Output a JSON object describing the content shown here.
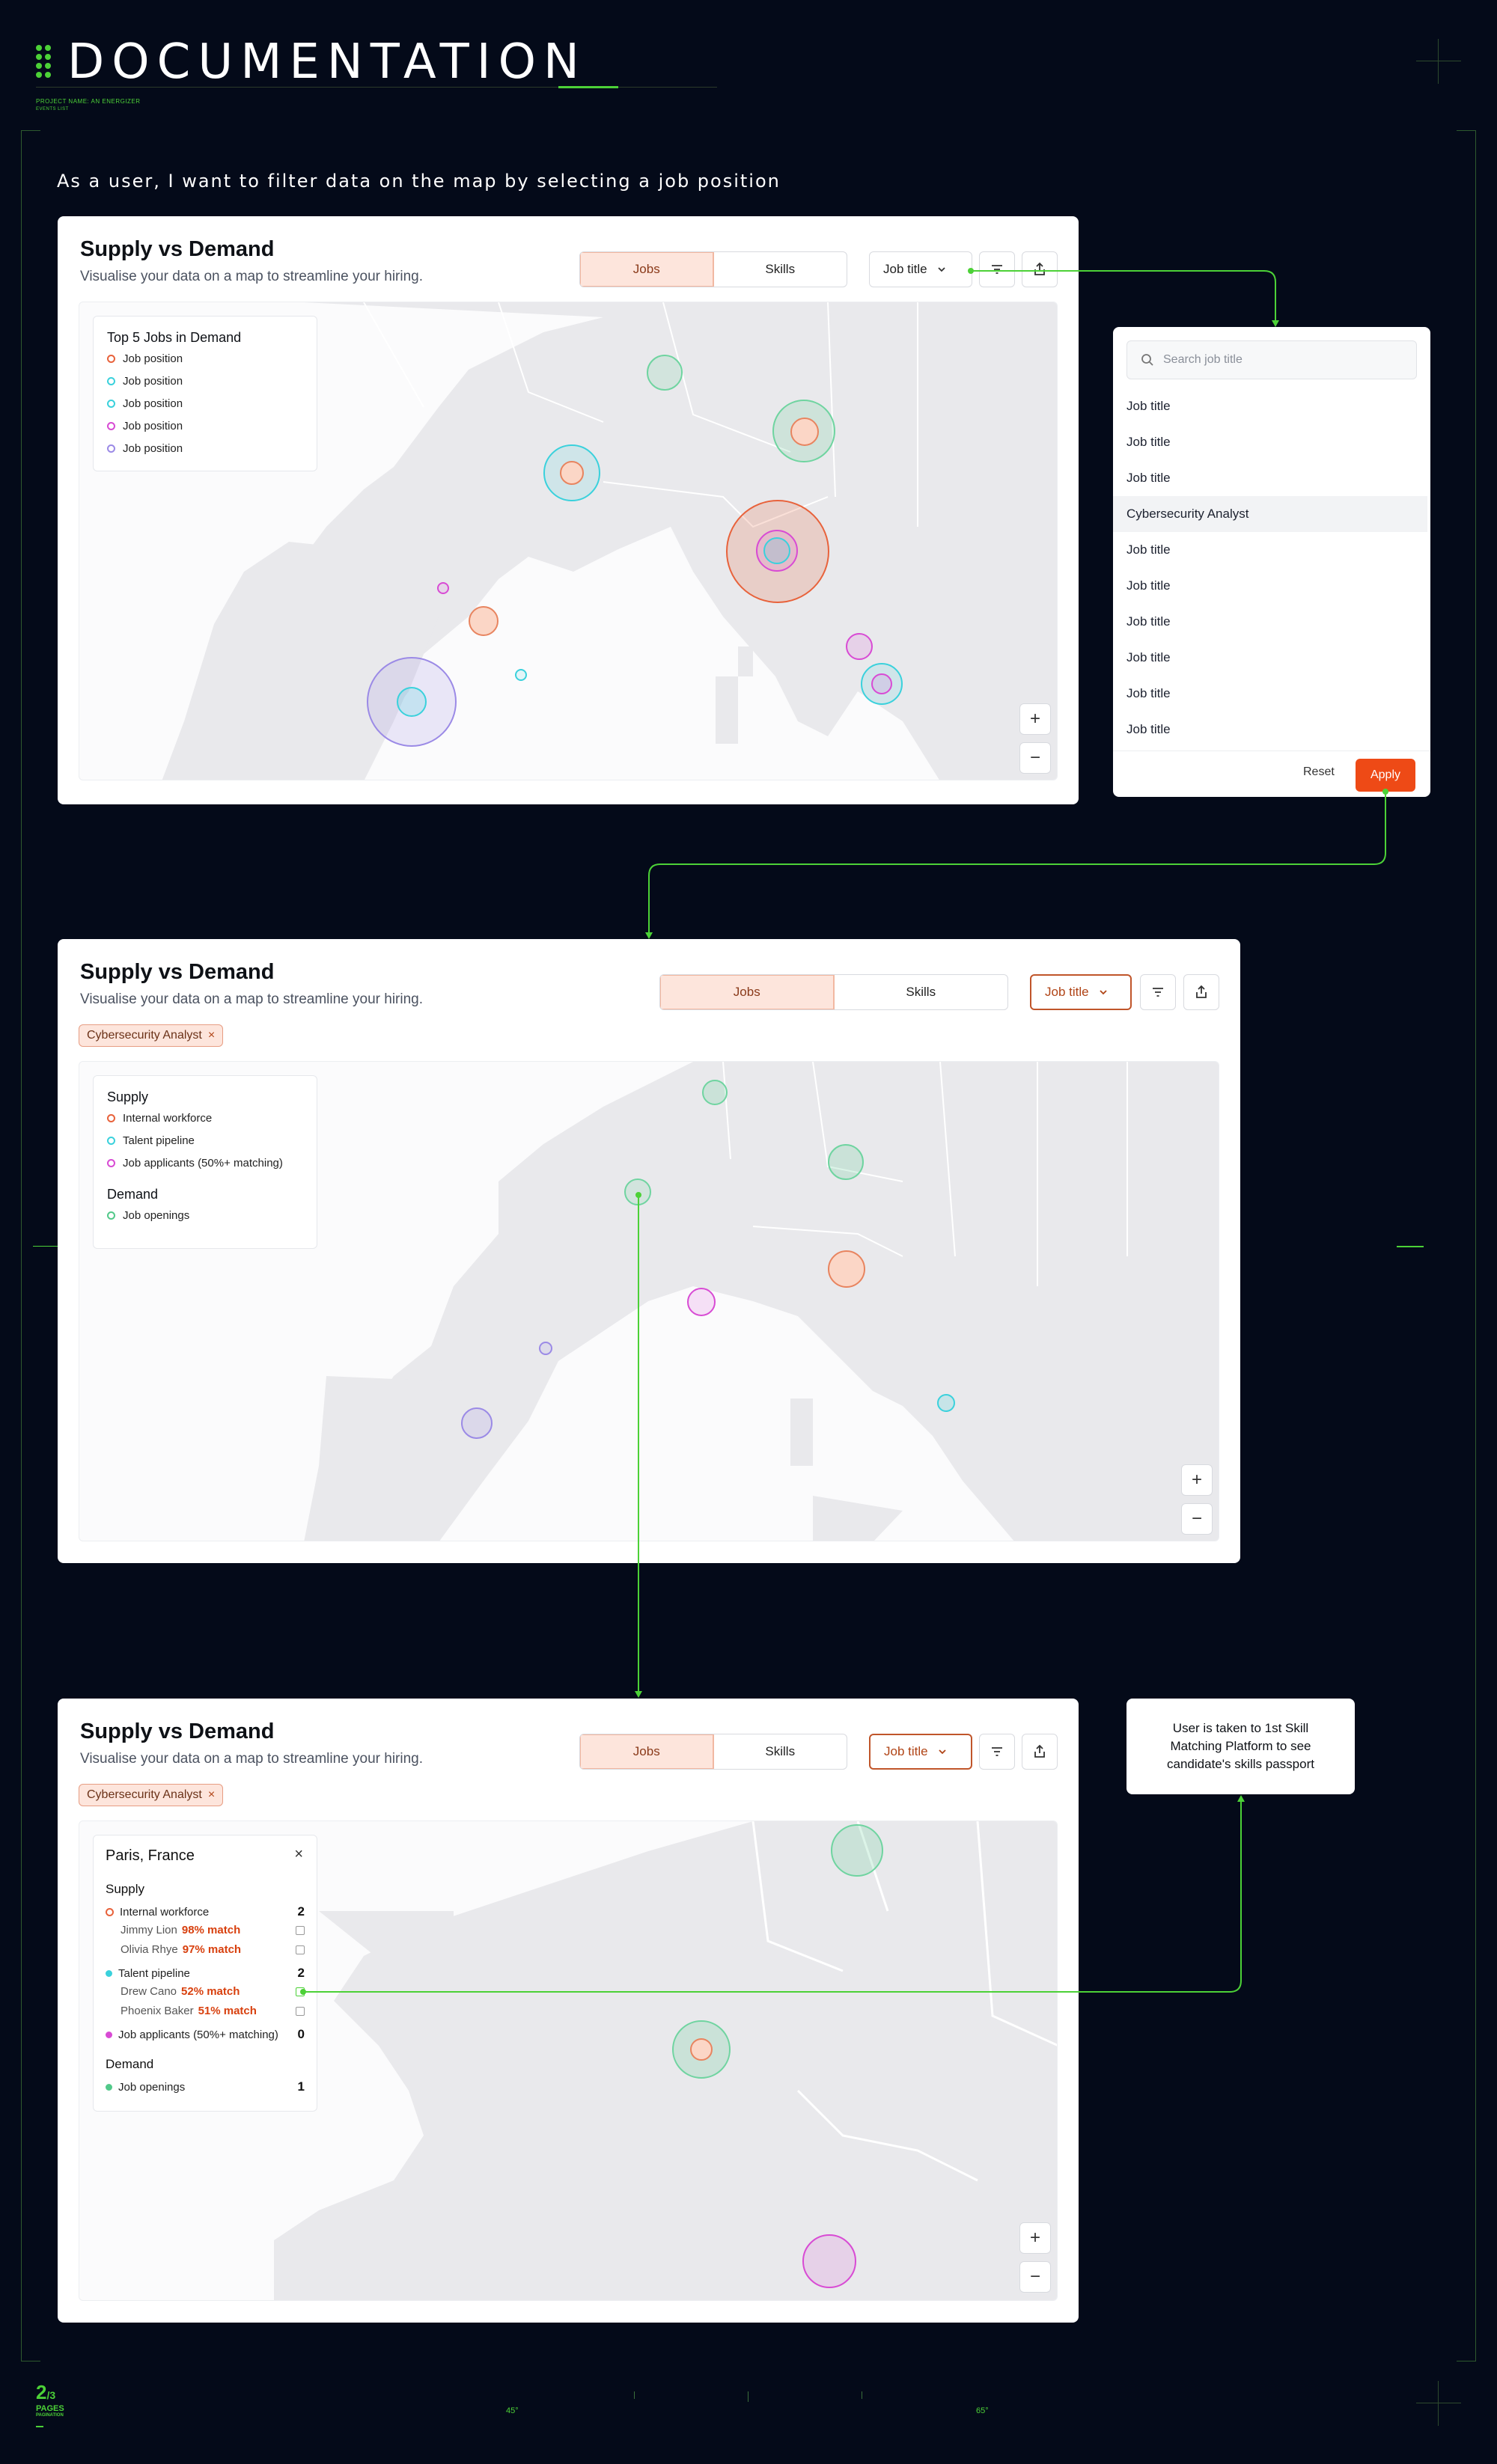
{
  "header": {
    "title": "DOCUMENTATION",
    "project": "PROJECT NAME: AN ENERGIZER",
    "project_sub": "EVENTS LIST"
  },
  "story": "As a user, I want to filter data on the map by selecting a job position",
  "panel1": {
    "title": "Supply vs Demand",
    "subtitle": "Visualise your data on a map to streamline your hiring.",
    "tabs": [
      "Jobs",
      "Skills"
    ],
    "dropdown_label": "Job title",
    "legend": {
      "title": "Top 5 Jobs in Demand",
      "items": [
        "Job position",
        "Job position",
        "Job position",
        "Job position",
        "Job position"
      ]
    }
  },
  "dropdown": {
    "search_placeholder": "Search job title",
    "items": [
      "Job title",
      "Job title",
      "Job title",
      "Cybersecurity Analyst",
      "Job title",
      "Job title",
      "Job title",
      "Job title",
      "Job title",
      "Job title"
    ],
    "reset": "Reset",
    "apply": "Apply"
  },
  "panel2": {
    "title": "Supply vs Demand",
    "subtitle": "Visualise your data on a map to streamline your hiring.",
    "tabs": [
      "Jobs",
      "Skills"
    ],
    "dropdown_label": "Job title",
    "chip": "Cybersecurity Analyst",
    "legend": {
      "supply_title": "Supply",
      "supply_items": [
        "Internal workforce",
        "Talent pipeline",
        "Job applicants (50%+ matching)"
      ],
      "demand_title": "Demand",
      "demand_items": [
        "Job openings"
      ]
    }
  },
  "panel3": {
    "title": "Supply vs Demand",
    "subtitle": "Visualise your data on a map to streamline your hiring.",
    "tabs": [
      "Jobs",
      "Skills"
    ],
    "dropdown_label": "Job title",
    "chip": "Cybersecurity Analyst",
    "popup": {
      "location": "Paris, France",
      "supply_title": "Supply",
      "internal": {
        "label": "Internal workforce",
        "count": "2",
        "people": [
          {
            "name": "Jimmy Lion",
            "match": "98% match"
          },
          {
            "name": "Olivia Rhye",
            "match": "97% match"
          }
        ]
      },
      "pipeline": {
        "label": "Talent pipeline",
        "count": "2",
        "people": [
          {
            "name": "Drew Cano",
            "match": "52% match"
          },
          {
            "name": "Phoenix Baker",
            "match": "51% match"
          }
        ]
      },
      "applicants": {
        "label": "Job applicants (50%+ matching)",
        "count": "0"
      },
      "demand_title": "Demand",
      "openings": {
        "label": "Job openings",
        "count": "1"
      }
    }
  },
  "note": "User is taken to 1st Skill Matching Platform to see candidate's skills passport",
  "footer": {
    "page": "2",
    "of": "/3",
    "pages_label": "PAGES",
    "sub": "PAGINATION",
    "tick_left": "45°",
    "tick_right": "65°"
  },
  "colors": {
    "accent_green": "#4cd137",
    "orange": "#e8623b",
    "cyan": "#3ad1dc",
    "magenta": "#d84bd4",
    "purple": "#9b8ae6",
    "mint": "#52c98a"
  }
}
